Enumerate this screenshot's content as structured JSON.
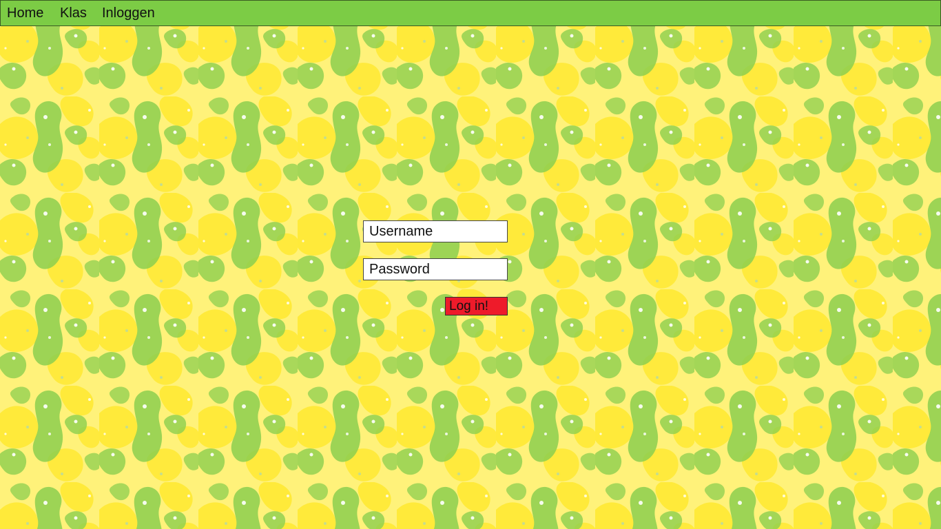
{
  "nav": {
    "items": [
      {
        "label": "Home"
      },
      {
        "label": "Klas"
      },
      {
        "label": "Inloggen"
      }
    ]
  },
  "login": {
    "username_placeholder": "Username",
    "password_placeholder": "Password",
    "submit_label": "Log in!"
  },
  "colors": {
    "nav_background": "#7ccc45",
    "page_background": "#fff27a",
    "pattern_green": "#8ccf4f",
    "pattern_yellow": "#ffe933",
    "button_background": "#ee1b2a"
  }
}
